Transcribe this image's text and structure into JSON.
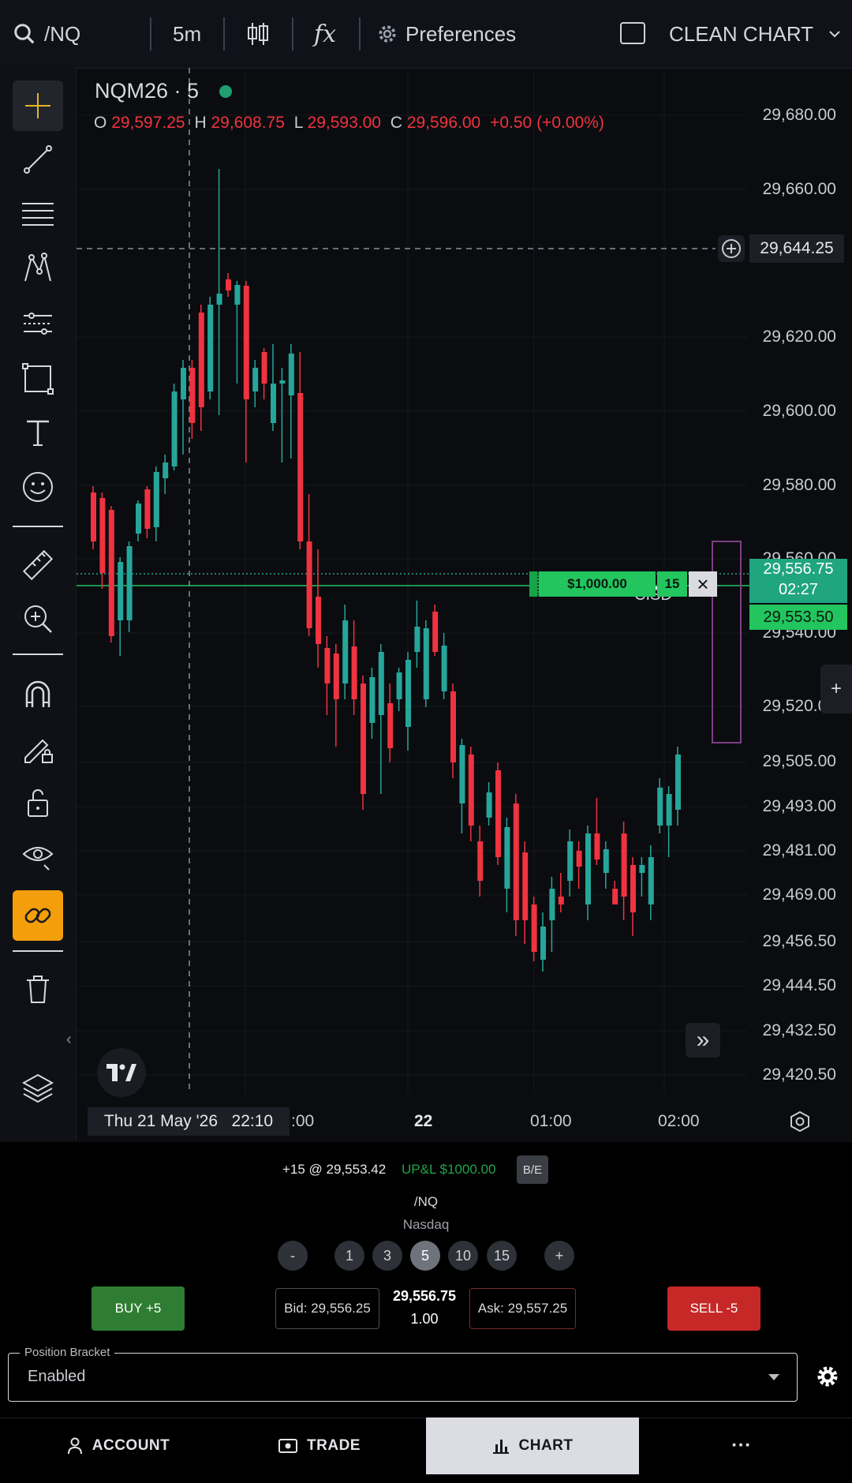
{
  "topbar": {
    "symbol": "/NQ",
    "interval": "5m",
    "fx_label": "fx",
    "preferences": "Preferences",
    "clean_chart": "CLEAN CHART"
  },
  "legend": {
    "title": "NQM26 · 5",
    "o_label": "O",
    "o_value": "29,597.25",
    "h_label": "H",
    "h_value": "29,608.75",
    "l_label": "L",
    "l_value": "29,593.00",
    "c_label": "C",
    "c_value": "29,596.00",
    "change": "+0.50 (+0.00%)"
  },
  "price_axis": [
    "29,680.00",
    "29,660.00",
    "29,620.00",
    "29,600.00",
    "29,580.00",
    "29,560.00",
    "29,540.00",
    "29,520.00",
    "29,505.00",
    "29,493.00",
    "29,481.00",
    "29,469.00",
    "29,456.50",
    "29,444.50",
    "29,432.50",
    "29,420.50"
  ],
  "crosshair_price": "29,644.25",
  "last_price": {
    "price": "29,556.75",
    "countdown": "02:27"
  },
  "position_price": "29,553.50",
  "position_line": {
    "pnl": "$1,000.00",
    "qty": "15",
    "close": "×"
  },
  "cisd_label": "CISD",
  "time_axis": {
    "crosshair": "Thu 21 May '26   22:10",
    "t1": ":00",
    "t2": "22",
    "t3": "01:00",
    "t4": "02:00"
  },
  "side_add": "+",
  "scroll_right": "»",
  "collapse": "‹",
  "position_summary": {
    "pos": "+15 @ 29,553.42",
    "upl": "UP&L $1000.00",
    "be": "B/E"
  },
  "instrument": {
    "symbol": "/NQ",
    "exchange": "Nasdaq"
  },
  "qty_buttons": {
    "minus": "-",
    "q1": "1",
    "q3": "3",
    "q5": "5",
    "q10": "10",
    "q15": "15",
    "plus": "+"
  },
  "order": {
    "buy": "BUY +5",
    "bid": "Bid: 29,556.25",
    "last": "29,556.75",
    "size": "1.00",
    "ask": "Ask: 29,557.25",
    "sell": "SELL -5"
  },
  "bracket": {
    "label": "Position Bracket",
    "value": "Enabled"
  },
  "nav": {
    "account": "ACCOUNT",
    "trade": "TRADE",
    "chart": "CHART",
    "more": "···"
  },
  "colors": {
    "up": "#26a69a",
    "down": "#ef3340",
    "green_label": "#22c55e",
    "buy": "#2e7d32",
    "sell": "#c62828",
    "link_tool": "#f59e0b"
  }
}
